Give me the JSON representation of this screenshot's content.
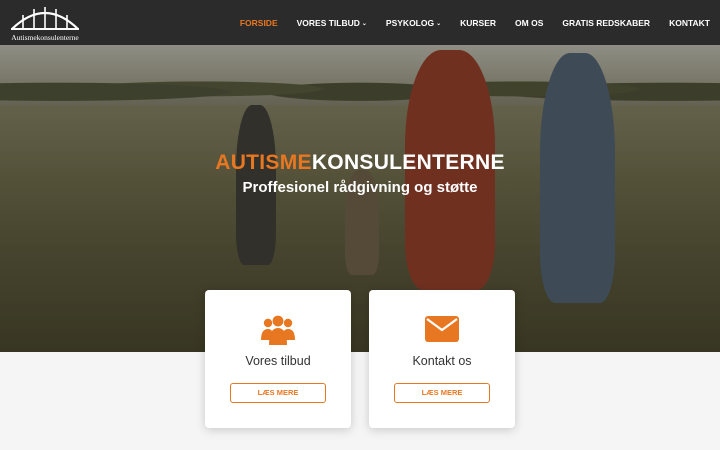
{
  "brand": {
    "logo_text": "Autismekonsulenterne",
    "accent_color": "#e87722"
  },
  "nav": {
    "items": [
      {
        "label": "FORSIDE",
        "active": true,
        "dropdown": false
      },
      {
        "label": "VORES TILBUD",
        "active": false,
        "dropdown": true
      },
      {
        "label": "PSYKOLOG",
        "active": false,
        "dropdown": true
      },
      {
        "label": "KURSER",
        "active": false,
        "dropdown": false
      },
      {
        "label": "OM OS",
        "active": false,
        "dropdown": false
      },
      {
        "label": "GRATIS REDSKABER",
        "active": false,
        "dropdown": false
      },
      {
        "label": "KONTAKT",
        "active": false,
        "dropdown": false
      }
    ]
  },
  "hero": {
    "title_accent": "AUTISME",
    "title_rest": "KONSULENTERNE",
    "subtitle": "Proffesionel rådgivning og støtte"
  },
  "cards": [
    {
      "icon": "group-icon",
      "title": "Vores tilbud",
      "button": "LÆS MERE"
    },
    {
      "icon": "envelope-icon",
      "title": "Kontakt os",
      "button": "LÆS MERE"
    }
  ]
}
